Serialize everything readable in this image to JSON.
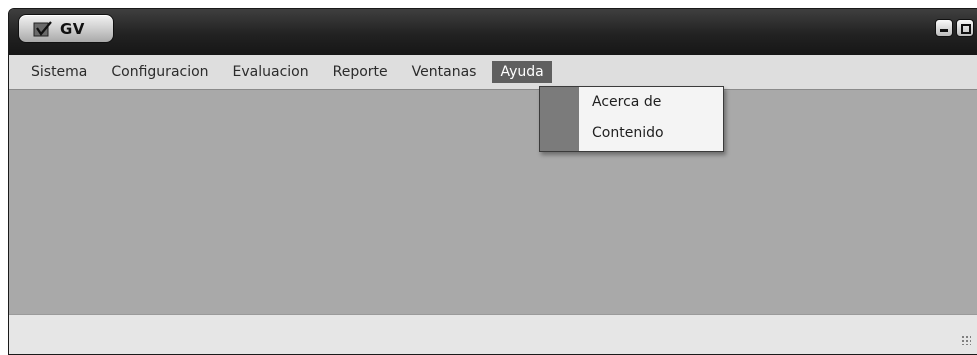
{
  "window": {
    "title": "GV",
    "app_icon": "gv-logo-icon",
    "controls": [
      "minimize-icon",
      "maximize-icon",
      "close-icon"
    ]
  },
  "menubar": {
    "items": [
      {
        "label": "Sistema"
      },
      {
        "label": "Configuracion"
      },
      {
        "label": "Evaluacion"
      },
      {
        "label": "Reporte"
      },
      {
        "label": "Ventanas"
      },
      {
        "label": "Ayuda",
        "active": true
      }
    ]
  },
  "dropdown": {
    "parent": "Ayuda",
    "items": [
      {
        "label": "Acerca de"
      },
      {
        "label": "Contenido"
      }
    ]
  },
  "colors": {
    "titlebar": "#222222",
    "menubar": "#dedede",
    "content": "#a9a9a9",
    "active_menu": "#5f5f5f"
  }
}
